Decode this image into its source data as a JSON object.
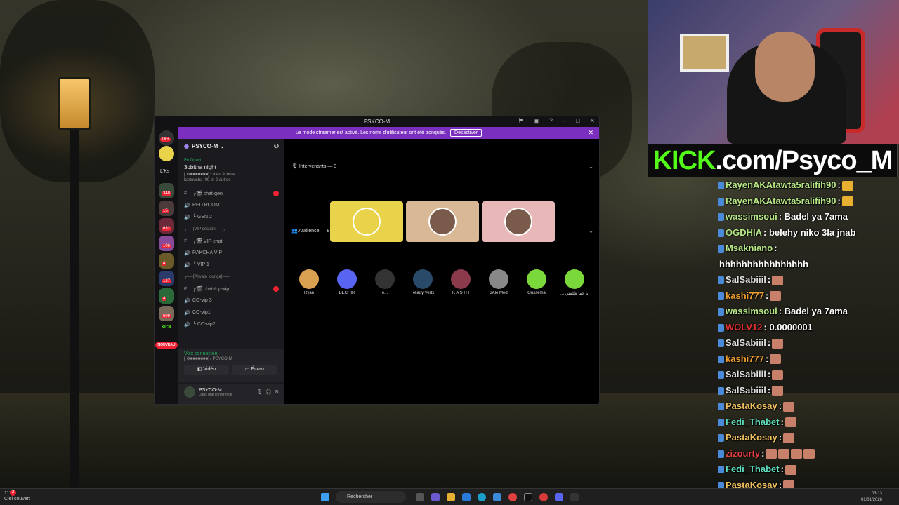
{
  "kick_banner": {
    "brand": "KICK",
    "url": ".com/Psyco_M"
  },
  "chat": [
    {
      "user": "RayenAKAtawta5ralifih90",
      "text": ":",
      "color": "#b8e986",
      "emote": "gold"
    },
    {
      "user": "RayenAKAtawta5ralifih90",
      "text": ":",
      "color": "#b8e986",
      "emote": "gold"
    },
    {
      "user": "wassimsoui",
      "text": ": Badel ya 7ama",
      "color": "#b8e986",
      "emote": ""
    },
    {
      "user": "OGDHIA",
      "text": ": belehy niko 3la jnab",
      "color": "#b8e986",
      "emote": ""
    },
    {
      "user": "Msakniano",
      "text": ":",
      "color": "#b8e986",
      "emote": ""
    },
    {
      "user": "",
      "text": "hhhhhhhhhhhhhhhh",
      "color": "#ffffff",
      "emote": ""
    },
    {
      "user": "SalSabiiil",
      "text": ":",
      "color": "#e0e0e0",
      "emote": "red"
    },
    {
      "user": "kashi777",
      "text": ":",
      "color": "#f0a030",
      "emote": "red"
    },
    {
      "user": "wassimsoui",
      "text": ": Badel ya 7ama",
      "color": "#b8e986",
      "emote": ""
    },
    {
      "user": "WOLV12",
      "text": ": 0.0000001",
      "color": "#e03030",
      "emote": ""
    },
    {
      "user": "SalSabiiil",
      "text": ":",
      "color": "#e0e0e0",
      "emote": "red"
    },
    {
      "user": "kashi777",
      "text": ":",
      "color": "#f0a030",
      "emote": "red"
    },
    {
      "user": "SalSabiiil",
      "text": ":",
      "color": "#e0e0e0",
      "emote": "red"
    },
    {
      "user": "SalSabiiil",
      "text": ":",
      "color": "#e0e0e0",
      "emote": "red"
    },
    {
      "user": "PastaKosay",
      "text": ":",
      "color": "#f0c060",
      "emote": "red"
    },
    {
      "user": "Fedi_Thabet",
      "text": ":",
      "color": "#60e0c0",
      "emote": "red"
    },
    {
      "user": "PastaKosay",
      "text": ":",
      "color": "#f0c060",
      "emote": "red"
    },
    {
      "user": "zizourty",
      "text": ":",
      "color": "#e04040",
      "emote": "red4"
    },
    {
      "user": "Fedi_Thabet",
      "text": ":",
      "color": "#60e0c0",
      "emote": "red"
    },
    {
      "user": "PastaKosay",
      "text": ":",
      "color": "#f0c060",
      "emote": "red"
    },
    {
      "user": "PastaKosay",
      "text": ":",
      "color": "#f0c060",
      "emote": "red"
    }
  ],
  "discord": {
    "window_title": "PSYCO-M",
    "banner_text": "Le mode streamer est activé. Les noms d'utilisateur ont été tronqués.",
    "banner_button": "Désactiver",
    "server_badge_top": "1K+",
    "server_label": "L'Ks",
    "server_badges": [
      "348",
      "15",
      "632",
      "106",
      "4",
      "127",
      "4",
      "699"
    ],
    "server_new": "NOUVEAU",
    "kick_icon": "KICK",
    "server_name": "PSYCO-M",
    "event_status": "En Direct",
    "event_title": "3obitha night",
    "event_listeners": "[ ⚙■■■■■■■] • 8 en écoute",
    "event_others": "kartoucha_09 et 2 autres",
    "channels": [
      {
        "icon": "#",
        "label": "┌🎬 chat-gen",
        "cat": false,
        "unread": true
      },
      {
        "icon": "🔊",
        "label": "RED ROOM",
        "cat": false,
        "unread": false
      },
      {
        "icon": "🔊",
        "label": "└ GEN 2",
        "cat": false,
        "unread": false
      },
      {
        "icon": "",
        "label": "┌──[VIP section]──┐",
        "cat": true,
        "unread": false
      },
      {
        "icon": "#",
        "label": "┌🎬 VIP-chat",
        "cat": false,
        "unread": false
      },
      {
        "icon": "🔊",
        "label": "RAKCHA VIP",
        "cat": false,
        "unread": false
      },
      {
        "icon": "🔊",
        "label": "└ VIP 1",
        "cat": false,
        "unread": false
      },
      {
        "icon": "",
        "label": "┌──[Private lounge]──┐",
        "cat": true,
        "unread": false
      },
      {
        "icon": "#",
        "label": "┌🎬 chat-top-vip",
        "cat": false,
        "unread": true
      },
      {
        "icon": "🔊",
        "label": "CO-vip 3",
        "cat": false,
        "unread": false
      },
      {
        "icon": "🔊",
        "label": "CO-vip1",
        "cat": false,
        "unread": false
      },
      {
        "icon": "🔊",
        "label": "└ CO-vip2",
        "cat": false,
        "unread": false
      }
    ],
    "voice_status": "Voix connectée",
    "voice_server": "[ ⚙■■■■■■■] / PSYCO-M",
    "video_label": "Vidéo",
    "screen_label": "Écran",
    "user_name": "PSYCO-M",
    "user_status": "Dans une conférence",
    "speakers_label": "Intervenants — 3",
    "audience_label": "Audience — 8",
    "speaker_colors": [
      "#e8d34a",
      "#d8b895",
      "#e8b8b8"
    ],
    "audience": [
      {
        "name": "Ryan",
        "color": "#d8a050"
      },
      {
        "name": "BECHIR",
        "color": "#5865f2"
      },
      {
        "name": "e...",
        "color": "#333333"
      },
      {
        "name": "Ready Vertx",
        "color": "#2a4a6a"
      },
      {
        "name": "K A S H I",
        "color": "#8a3a4a"
      },
      {
        "name": "3Alé Med",
        "color": "#888888"
      },
      {
        "name": "Oussema",
        "color": "#7ad83a"
      },
      {
        "name": "... يا حما ظلمتي 😏",
        "color": "#7ad83a"
      }
    ]
  },
  "taskbar": {
    "weather_temp": "11°C",
    "weather_desc": "Ciel couvert",
    "search_placeholder": "Rechercher",
    "time": "03:13",
    "date": "01/01/2026",
    "notif_count": "2"
  }
}
